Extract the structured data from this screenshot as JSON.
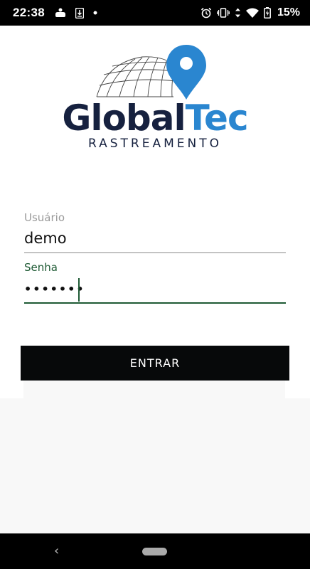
{
  "status_bar": {
    "time": "22:38",
    "battery_percent": "15%",
    "left_icons": [
      "gamepad-icon",
      "download-icon",
      "dot-icon"
    ],
    "right_icons": [
      "alarm-icon",
      "vibrate-icon",
      "data-arrows-icon",
      "wifi-icon",
      "battery-charging-icon"
    ]
  },
  "logo": {
    "brand_dark": "Global",
    "brand_light": "Tec",
    "tagline": "RASTREAMENTO",
    "icons": [
      "globe-icon",
      "map-pin-icon"
    ],
    "colors": {
      "dark": "#16213f",
      "blue": "#2a86d0"
    }
  },
  "form": {
    "username": {
      "label": "Usuário",
      "value": "demo"
    },
    "password": {
      "label": "Senha",
      "value": "•••••••"
    },
    "submit_label": "ENTRAR",
    "accent_color": "#1e5a34"
  },
  "nav_bar": {
    "icons": [
      "back-icon",
      "home-pill-icon"
    ]
  }
}
